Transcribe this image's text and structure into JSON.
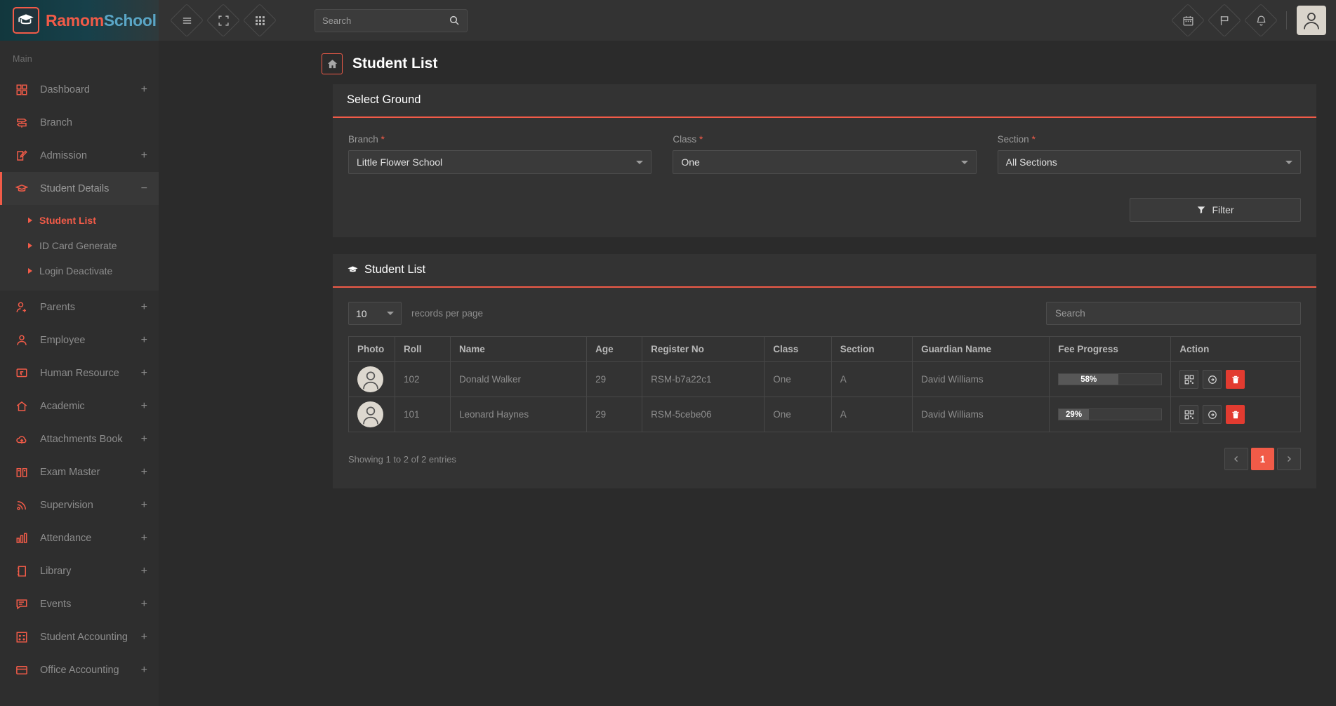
{
  "brand": {
    "part1": "Ramom",
    "part2": "School",
    "logo_icon": "graduation-cap-icon"
  },
  "topbar": {
    "menu_icon": "hamburger-menu-icon",
    "fullscreen_icon": "fullscreen-icon",
    "apps_icon": "grid-apps-icon",
    "search_placeholder": "Search",
    "search_value": "",
    "search_icon": "search-icon",
    "calendar_icon": "calendar-icon",
    "flag_icon": "flag-icon",
    "bell_icon": "bell-icon",
    "avatar_icon": "user-avatar-icon"
  },
  "sidebar": {
    "section_label": "Main",
    "items": [
      {
        "label": "Dashboard",
        "icon": "dashboard-grid-icon",
        "expand": "+",
        "active": false
      },
      {
        "label": "Branch",
        "icon": "signpost-icon",
        "expand": "",
        "active": false
      },
      {
        "label": "Admission",
        "icon": "edit-square-icon",
        "expand": "+",
        "active": false
      },
      {
        "label": "Student Details",
        "icon": "graduation-cap-icon",
        "expand": "−",
        "active": true
      },
      {
        "label": "Parents",
        "icon": "user-add-icon",
        "expand": "+",
        "active": false
      },
      {
        "label": "Employee",
        "icon": "user-icon",
        "expand": "+",
        "active": false
      },
      {
        "label": "Human Resource",
        "icon": "screen-return-icon",
        "expand": "+",
        "active": false
      },
      {
        "label": "Academic",
        "icon": "home-icon",
        "expand": "+",
        "active": false
      },
      {
        "label": "Attachments Book",
        "icon": "cloud-upload-icon",
        "expand": "+",
        "active": false
      },
      {
        "label": "Exam Master",
        "icon": "open-book-icon",
        "expand": "+",
        "active": false
      },
      {
        "label": "Supervision",
        "icon": "rss-signal-icon",
        "expand": "+",
        "active": false
      },
      {
        "label": "Attendance",
        "icon": "bar-chart-icon",
        "expand": "+",
        "active": false
      },
      {
        "label": "Library",
        "icon": "notebook-icon",
        "expand": "+",
        "active": false
      },
      {
        "label": "Events",
        "icon": "speech-bubble-icon",
        "expand": "+",
        "active": false
      },
      {
        "label": "Student Accounting",
        "icon": "calculator-icon",
        "expand": "+",
        "active": false
      },
      {
        "label": "Office Accounting",
        "icon": "credit-card-icon",
        "expand": "+",
        "active": false
      }
    ],
    "submenu": [
      {
        "label": "Student List",
        "current": true
      },
      {
        "label": "ID Card Generate",
        "current": false
      },
      {
        "label": "Login Deactivate",
        "current": false
      }
    ]
  },
  "page": {
    "title": "Student List",
    "home_icon": "home-icon"
  },
  "select_ground": {
    "title": "Select Ground",
    "fields": [
      {
        "label": "Branch",
        "required": "*",
        "value": "Little Flower School"
      },
      {
        "label": "Class",
        "required": "*",
        "value": "One"
      },
      {
        "label": "Section",
        "required": "*",
        "value": "All Sections"
      }
    ],
    "filter_label": "Filter",
    "filter_icon": "funnel-icon"
  },
  "student_list": {
    "title": "Student List",
    "title_icon": "graduation-cap-icon",
    "per_page_value": "10",
    "per_page_note": "records per page",
    "search_placeholder": "Search",
    "search_value": "",
    "columns": [
      "Photo",
      "Roll",
      "Name",
      "Age",
      "Register No",
      "Class",
      "Section",
      "Guardian Name",
      "Fee Progress",
      "Action"
    ],
    "rows": [
      {
        "photo_icon": "user-avatar-icon",
        "roll": "102",
        "name": "Donald Walker",
        "age": "29",
        "register_no": "RSM-b7a22c1",
        "class": "One",
        "section": "A",
        "guardian": "David Williams",
        "fee_percent": 58,
        "fee_label": "58%",
        "actions": [
          {
            "icon": "qr-code-icon",
            "style": "normal"
          },
          {
            "icon": "arrow-circle-right-icon",
            "style": "normal"
          },
          {
            "icon": "trash-icon",
            "style": "danger"
          }
        ]
      },
      {
        "photo_icon": "user-avatar-icon",
        "roll": "101",
        "name": "Leonard Haynes",
        "age": "29",
        "register_no": "RSM-5cebe06",
        "class": "One",
        "section": "A",
        "guardian": "David Williams",
        "fee_percent": 29,
        "fee_label": "29%",
        "actions": [
          {
            "icon": "qr-code-icon",
            "style": "normal"
          },
          {
            "icon": "arrow-circle-right-icon",
            "style": "normal"
          },
          {
            "icon": "trash-icon",
            "style": "danger"
          }
        ]
      }
    ],
    "footer_text": "Showing 1 to 2 of 2 entries",
    "pagination": {
      "prev_icon": "chevron-left-icon",
      "next_icon": "chevron-right-icon",
      "pages": [
        "1"
      ],
      "active_page": "1"
    }
  },
  "colors": {
    "accent": "#f15b48",
    "danger": "#e23b30",
    "sidebar_bg": "#2e2e2e",
    "card_bg": "#333333",
    "page_bg": "#2b2b2b",
    "brand_blue": "#5aa6c6"
  }
}
